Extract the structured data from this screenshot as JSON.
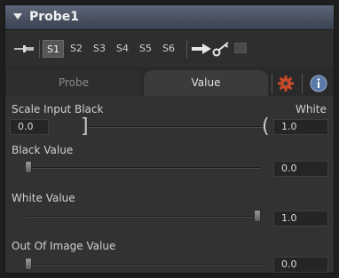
{
  "header": {
    "title": "Probe1",
    "collapse_icon": "triangle-down-icon"
  },
  "toolbar": {
    "pin_icon": "pin-icon",
    "slots": [
      "S1",
      "S2",
      "S3",
      "S4",
      "S5",
      "S6"
    ],
    "active_slot": "S1",
    "view_arrow_icon": "arrow-right-icon",
    "key_icon": "key-icon",
    "display_icon": "screen-icon"
  },
  "tabs": {
    "items": [
      "Probe",
      "Value"
    ],
    "active": "Value",
    "gear_icon": "gear-icon",
    "info_icon": "info-icon"
  },
  "scale_input": {
    "label_black": "Scale Input Black",
    "label_white": "White",
    "black_value": "0.0",
    "white_value": "1.0"
  },
  "black_value": {
    "label": "Black Value",
    "value": "0.0",
    "slider_fraction": 0.0
  },
  "white_value": {
    "label": "White Value",
    "value": "1.0",
    "slider_fraction": 1.0
  },
  "out_of_image_value": {
    "label": "Out Of Image Value",
    "value": "0.0",
    "slider_fraction": 0.0
  },
  "colors": {
    "header": "#4c5466",
    "panel": "#323232",
    "gear": "#c84a2a",
    "info": "#5a7aa8"
  }
}
